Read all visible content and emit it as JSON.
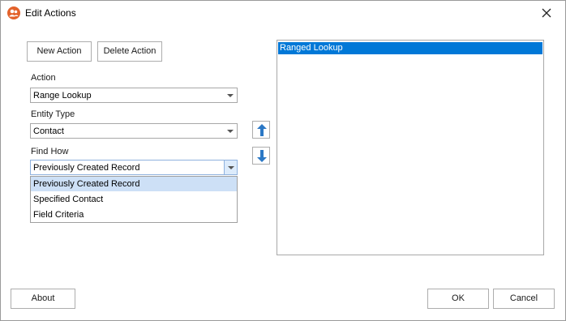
{
  "window": {
    "title": "Edit Actions",
    "accent": "#e3622b"
  },
  "toolbar": {
    "new_action_label": "New Action",
    "delete_action_label": "Delete Action"
  },
  "form": {
    "action": {
      "label": "Action",
      "value": "Range Lookup"
    },
    "entity_type": {
      "label": "Entity Type",
      "value": "Contact"
    },
    "find_how": {
      "label": "Find How",
      "value": "Previously Created Record",
      "options": [
        "Previously Created Record",
        "Specified Contact",
        "Field Criteria"
      ]
    }
  },
  "actions_list": {
    "items": [
      "Ranged Lookup"
    ],
    "selected_color": "#0078d7"
  },
  "footer": {
    "about_label": "About",
    "ok_label": "OK",
    "cancel_label": "Cancel"
  },
  "icons": {
    "app": "users-icon",
    "close": "close-icon",
    "move_up": "arrow-up-icon",
    "move_down": "arrow-down-icon",
    "dropdown": "chevron-down-icon"
  }
}
